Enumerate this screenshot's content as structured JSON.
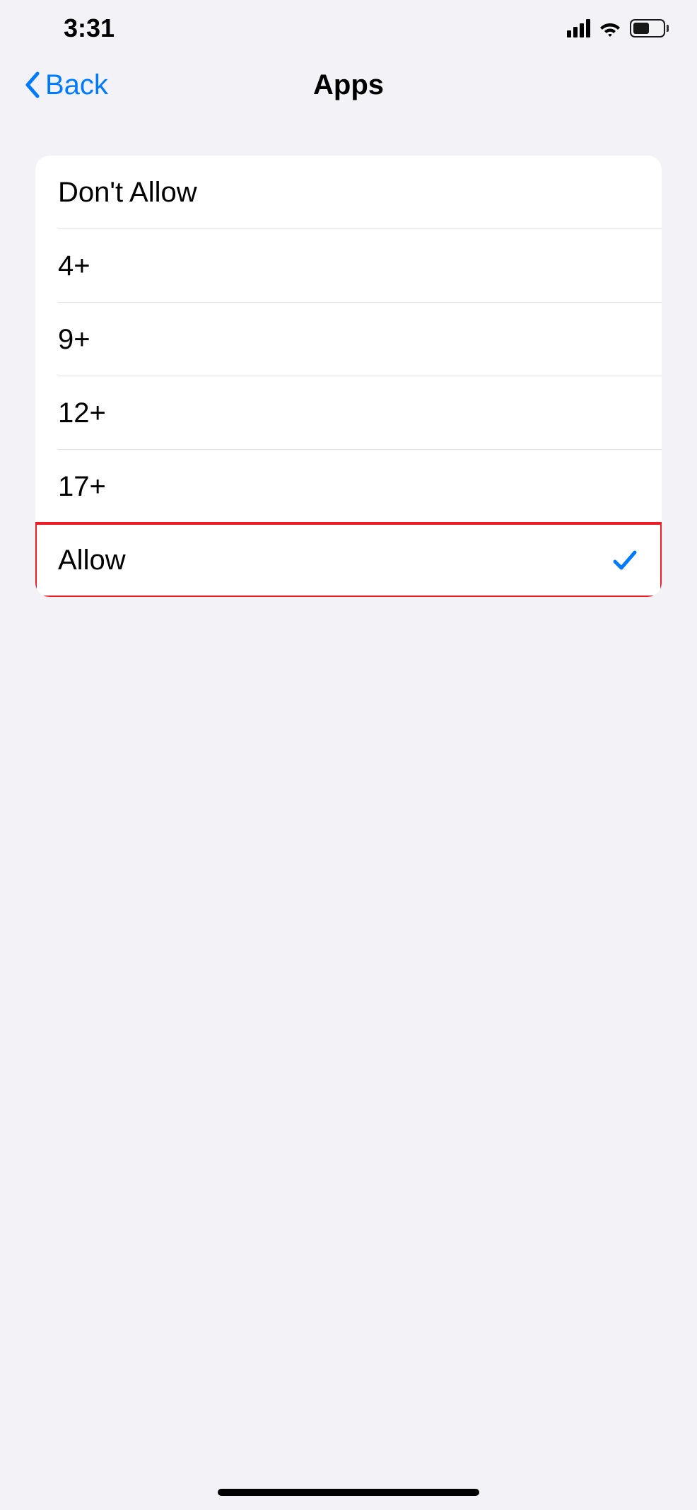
{
  "status": {
    "time": "3:31"
  },
  "nav": {
    "back_label": "Back",
    "title": "Apps"
  },
  "options": [
    {
      "label": "Don't Allow",
      "selected": false,
      "highlighted": false
    },
    {
      "label": "4+",
      "selected": false,
      "highlighted": false
    },
    {
      "label": "9+",
      "selected": false,
      "highlighted": false
    },
    {
      "label": "12+",
      "selected": false,
      "highlighted": false
    },
    {
      "label": "17+",
      "selected": false,
      "highlighted": false
    },
    {
      "label": "Allow",
      "selected": true,
      "highlighted": true
    }
  ]
}
